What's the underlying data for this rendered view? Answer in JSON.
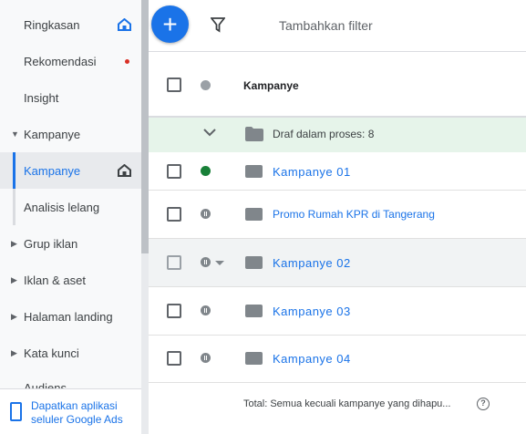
{
  "sidebar": {
    "items": [
      {
        "label": "Ringkasan"
      },
      {
        "label": "Rekomendasi"
      },
      {
        "label": "Insight"
      },
      {
        "label": "Kampanye"
      },
      {
        "label": "Kampanye"
      },
      {
        "label": "Analisis lelang"
      },
      {
        "label": "Grup iklan"
      },
      {
        "label": "Iklan & aset"
      },
      {
        "label": "Halaman landing"
      },
      {
        "label": "Kata kunci"
      },
      {
        "label": "Audiens"
      }
    ],
    "app_promo_line1": "Dapatkan aplikasi",
    "app_promo_line2": "seluler Google Ads"
  },
  "toolbar": {
    "add_label": "+",
    "filter_label": "Tambahkan filter"
  },
  "table": {
    "header": "Kampanye",
    "draft_label": "Draf dalam proses: 8",
    "rows": [
      {
        "name": "Kampanye 01",
        "status": "enabled"
      },
      {
        "name": "Promo Rumah KPR di Tangerang",
        "status": "paused"
      },
      {
        "name": "Kampanye 02",
        "status": "paused"
      },
      {
        "name": "Kampanye 03",
        "status": "paused"
      },
      {
        "name": "Kampanye 04",
        "status": "paused"
      }
    ],
    "total_label": "Total: Semua kecuali kampanye yang dihapu...",
    "help_label": "?"
  },
  "colors": {
    "accent": "#1a73e8",
    "enabled": "#188038",
    "paused": "#80868b",
    "draft_bg": "#e6f4ea"
  }
}
